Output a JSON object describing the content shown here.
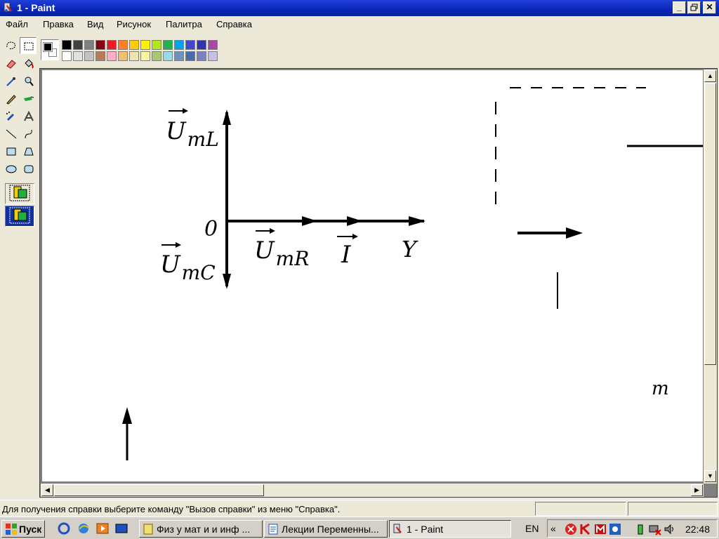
{
  "window": {
    "title": "1 - Paint"
  },
  "menu": [
    "Файл",
    "Правка",
    "Вид",
    "Рисунок",
    "Палитра",
    "Справка"
  ],
  "palette": {
    "row1": [
      "#000000",
      "#404040",
      "#7f7f7f",
      "#880015",
      "#ed1c24",
      "#ff7f27",
      "#ffc90e",
      "#fff200",
      "#b5e61d",
      "#22b14c",
      "#00a2e8",
      "#3f48cc",
      "#3333aa",
      "#a349a4"
    ],
    "row2": [
      "#ffffff",
      "#e0e0e0",
      "#c3c3c3",
      "#b97a57",
      "#ffaec9",
      "#f0c070",
      "#efe4b0",
      "#f6f6a0",
      "#a8c870",
      "#99d9ea",
      "#7092be",
      "#4a6aa8",
      "#7a80c0",
      "#c8bfe7"
    ]
  },
  "drawing": {
    "label_origin": "0",
    "label_uml": {
      "main": "U",
      "sub": "mL"
    },
    "label_umc": {
      "main": "U",
      "sub": "mC"
    },
    "label_umr": {
      "main": "U",
      "sub": "mR"
    },
    "label_i": "I",
    "label_y": "Y",
    "label_m": "m"
  },
  "status": {
    "text": "Для получения справки выберите команду \"Вызов справки\" из меню \"Справка\"."
  },
  "taskbar": {
    "start": "Пуск",
    "tasks": [
      "Физ у мат и и инф ...",
      "Лекции Переменны...",
      "1 - Paint"
    ],
    "lang": "EN",
    "clock": "22:48"
  },
  "icons": [
    "paint-icon",
    "minimize-icon",
    "restore-icon",
    "close-icon",
    "windows-logo-icon",
    "opera-icon",
    "ie-icon",
    "media-icon",
    "desktop-icon",
    "antivirus-icon",
    "kaspersky-icon",
    "mail-icon",
    "network-icon",
    "power-icon",
    "volume-icon"
  ]
}
